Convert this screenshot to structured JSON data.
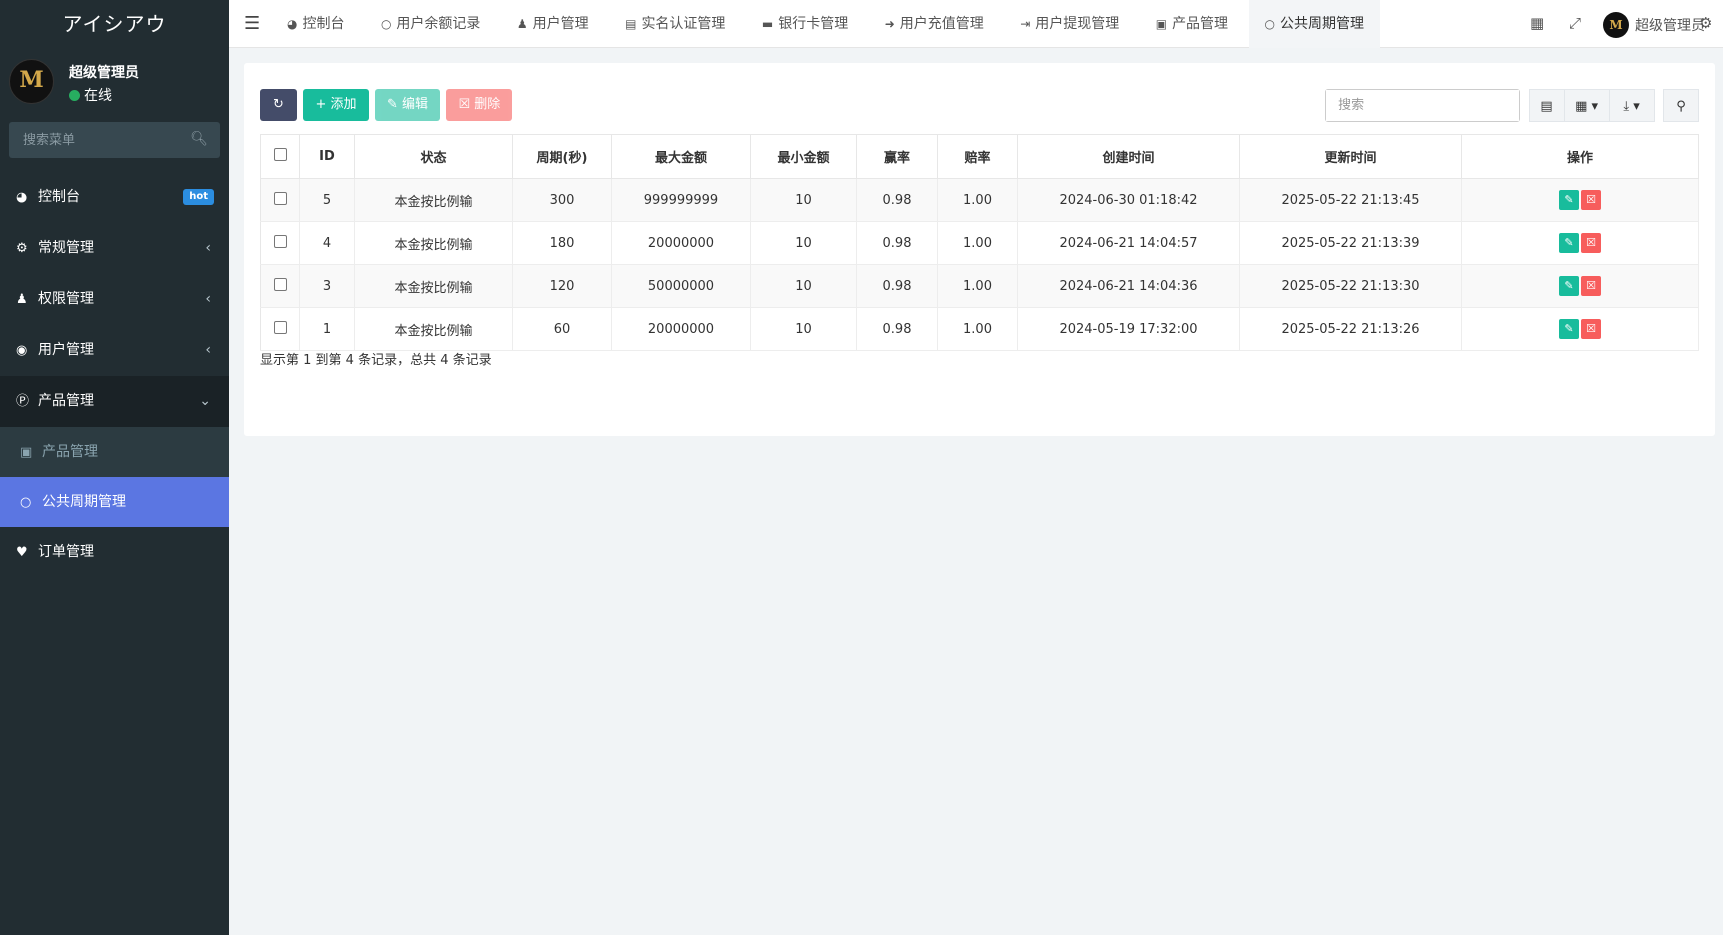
{
  "app": {
    "logo": "アイシアウ",
    "avatar_letter": "M"
  },
  "user": {
    "name": "超级管理员",
    "status": "在线"
  },
  "sidebar": {
    "search_placeholder": "搜索菜单",
    "items": [
      {
        "label": "控制台",
        "badge": "hot"
      },
      {
        "label": "常规管理"
      },
      {
        "label": "权限管理"
      },
      {
        "label": "用户管理"
      },
      {
        "label": "产品管理"
      },
      {
        "label": "订单管理"
      }
    ],
    "submenu": [
      {
        "label": "产品管理"
      },
      {
        "label": "公共周期管理"
      }
    ]
  },
  "tabs": [
    {
      "label": "控制台",
      "icon": "dashboard-icon"
    },
    {
      "label": "用户余额记录",
      "icon": "circle-icon"
    },
    {
      "label": "用户管理",
      "icon": "user-icon"
    },
    {
      "label": "实名认证管理",
      "icon": "id-card-icon"
    },
    {
      "label": "银行卡管理",
      "icon": "credit-card-icon"
    },
    {
      "label": "用户充值管理",
      "icon": "sign-in-icon"
    },
    {
      "label": "用户提现管理",
      "icon": "sign-out-icon"
    },
    {
      "label": "产品管理",
      "icon": "shopping-bag-icon"
    },
    {
      "label": "公共周期管理",
      "icon": "circle-icon"
    }
  ],
  "topbar": {
    "user_name": "超级管理员"
  },
  "toolbar": {
    "add": "添加",
    "edit": "编辑",
    "delete": "删除",
    "search_placeholder": "搜索"
  },
  "table": {
    "headers": [
      "ID",
      "状态",
      "周期(秒)",
      "最大金额",
      "最小金额",
      "赢率",
      "赔率",
      "创建时间",
      "更新时间",
      "操作"
    ],
    "rows": [
      [
        "5",
        "本金按比例输",
        "300",
        "999999999",
        "10",
        "0.98",
        "1.00",
        "2024-06-30 01:18:42",
        "2025-05-22 21:13:45"
      ],
      [
        "4",
        "本金按比例输",
        "180",
        "20000000",
        "10",
        "0.98",
        "1.00",
        "2024-06-21 14:04:57",
        "2025-05-22 21:13:39"
      ],
      [
        "3",
        "本金按比例输",
        "120",
        "50000000",
        "10",
        "0.98",
        "1.00",
        "2024-06-21 14:04:36",
        "2025-05-22 21:13:30"
      ],
      [
        "1",
        "本金按比例输",
        "60",
        "20000000",
        "10",
        "0.98",
        "1.00",
        "2024-05-19 17:32:00",
        "2025-05-22 21:13:26"
      ]
    ]
  },
  "pagination": {
    "info": "显示第 1 到第 4 条记录，总共 4 条记录"
  }
}
